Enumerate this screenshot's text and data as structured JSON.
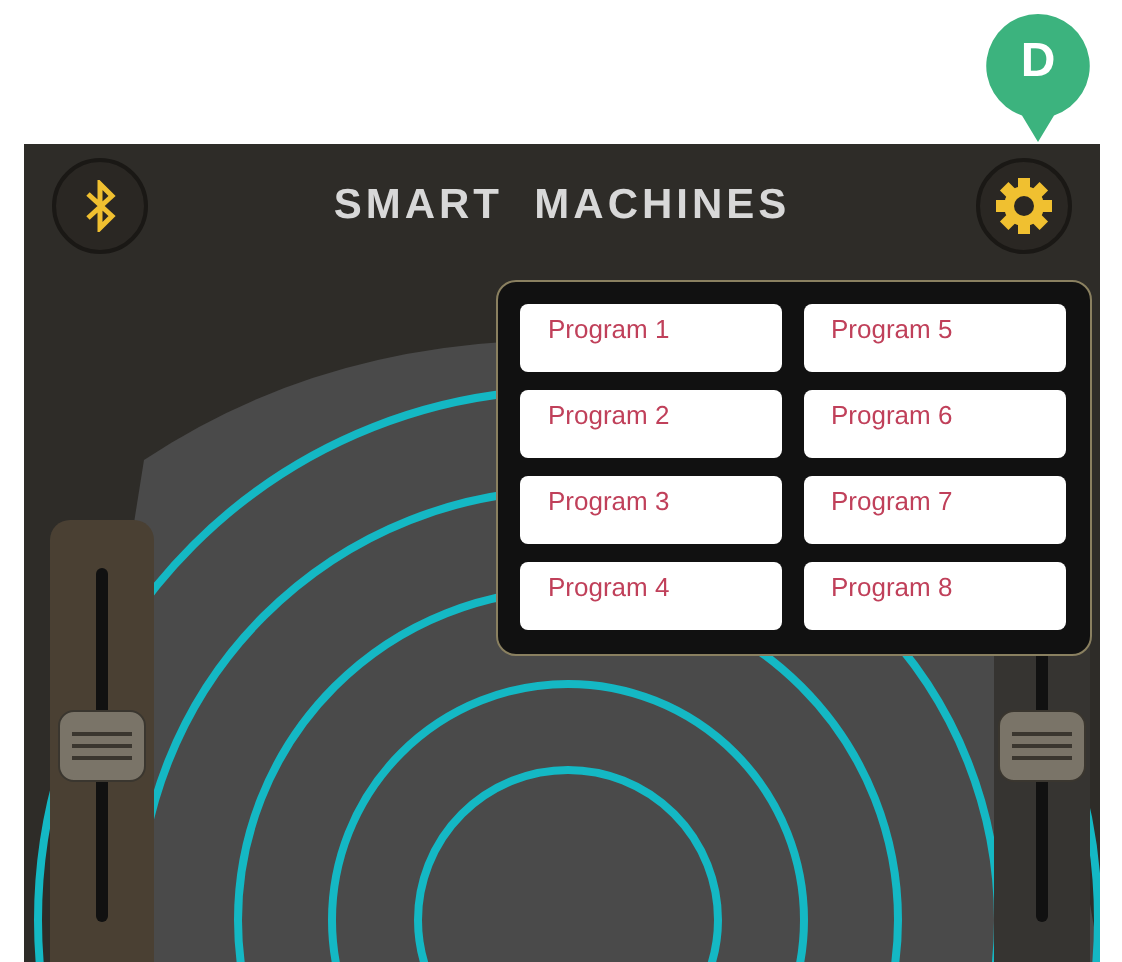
{
  "callout": {
    "label": "D"
  },
  "header": {
    "title": "SMART  MACHINES"
  },
  "programs": [
    {
      "label": "Program 1"
    },
    {
      "label": "Program 2"
    },
    {
      "label": "Program 3"
    },
    {
      "label": "Program 4"
    },
    {
      "label": "Program 5"
    },
    {
      "label": "Program 6"
    },
    {
      "label": "Program 7"
    },
    {
      "label": "Program 8"
    }
  ],
  "sliders": [
    {
      "level": 0.5
    },
    {
      "level": 0.5
    }
  ]
}
